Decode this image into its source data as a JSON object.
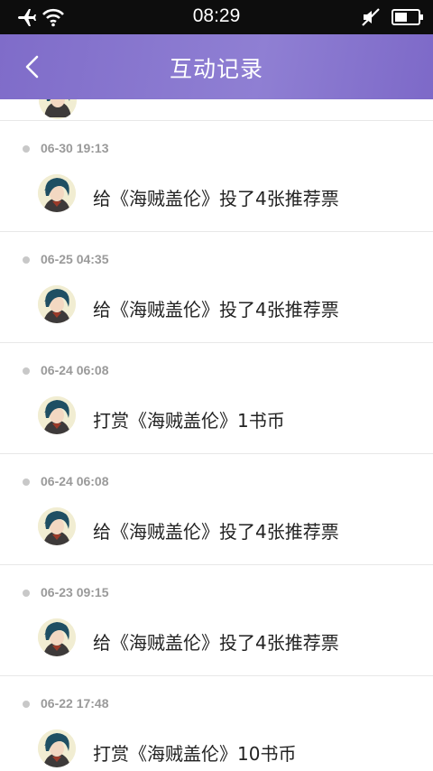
{
  "status_bar": {
    "time": "08:29",
    "icons": [
      "airplane-icon",
      "wifi-icon",
      "mute-icon",
      "battery-icon"
    ]
  },
  "header": {
    "title": "互动记录",
    "back_icon": "chevron-left-icon"
  },
  "records": [
    {
      "timestamp": "06-30 19:13",
      "text": "给《海贼盖伦》投了4张推荐票"
    },
    {
      "timestamp": "06-25 04:35",
      "text": "给《海贼盖伦》投了4张推荐票"
    },
    {
      "timestamp": "06-24 06:08",
      "text": "打赏《海贼盖伦》1书币"
    },
    {
      "timestamp": "06-24 06:08",
      "text": "给《海贼盖伦》投了4张推荐票"
    },
    {
      "timestamp": "06-23 09:15",
      "text": "给《海贼盖伦》投了4张推荐票"
    },
    {
      "timestamp": "06-22 17:48",
      "text": "打赏《海贼盖伦》10书币"
    }
  ],
  "colors": {
    "header": "#8a79d0",
    "status_bar": "#0d0d0d",
    "timestamp": "#9a9a9a",
    "divider": "#e8e8e8"
  }
}
